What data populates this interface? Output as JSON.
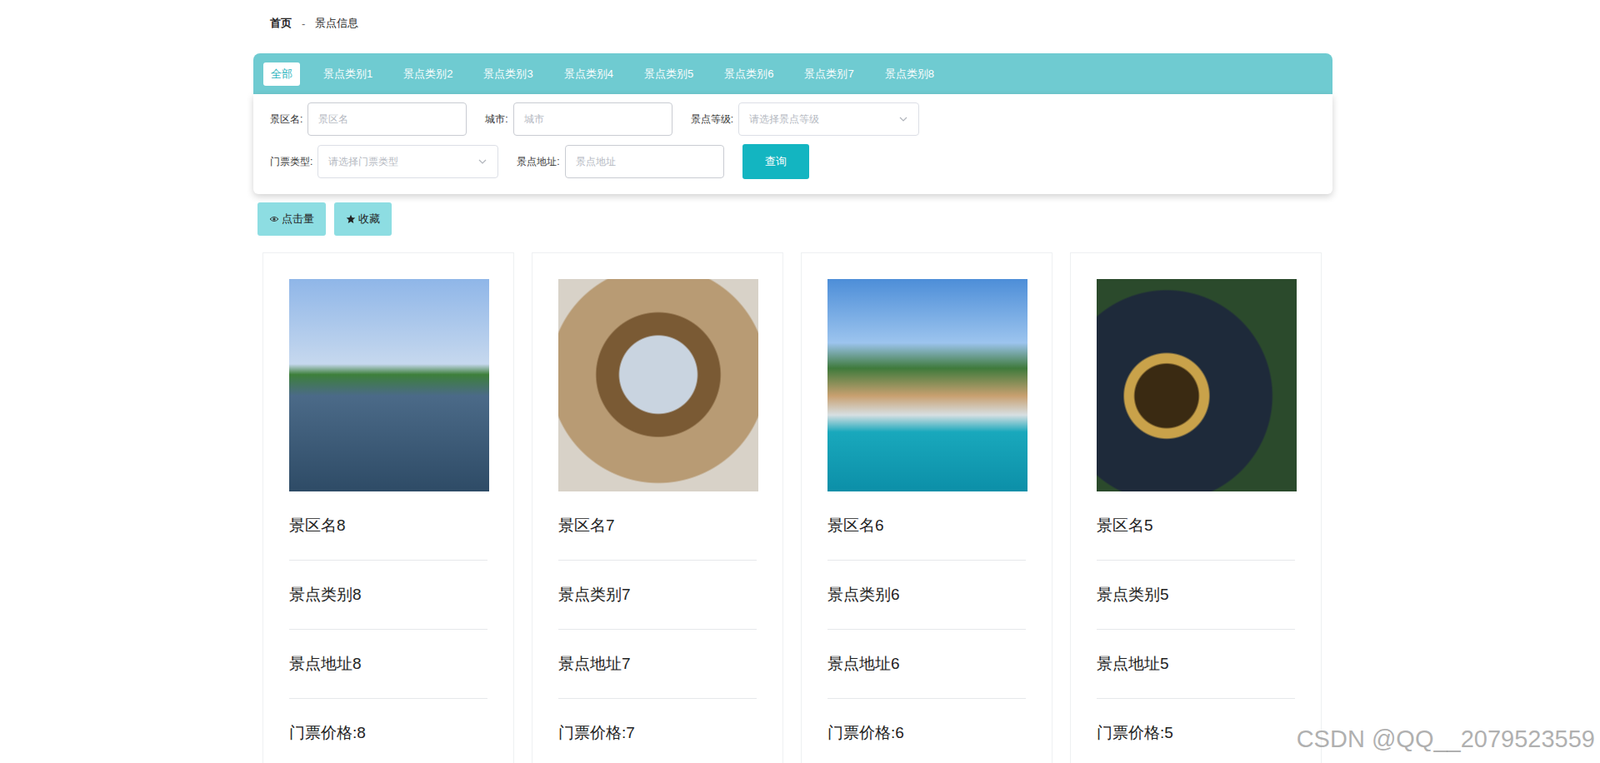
{
  "breadcrumb": {
    "items": [
      "首页",
      "景点信息"
    ],
    "separator": "-"
  },
  "tabs": [
    {
      "label": "全部",
      "selected": true
    },
    {
      "label": "景点类别1",
      "selected": false
    },
    {
      "label": "景点类别2",
      "selected": false
    },
    {
      "label": "景点类别3",
      "selected": false
    },
    {
      "label": "景点类别4",
      "selected": false
    },
    {
      "label": "景点类别5",
      "selected": false
    },
    {
      "label": "景点类别6",
      "selected": false
    },
    {
      "label": "景点类别7",
      "selected": false
    },
    {
      "label": "景点类别8",
      "selected": false
    }
  ],
  "filters": [
    {
      "label": "景区名:",
      "placeholder": "景区名",
      "kind": "input"
    },
    {
      "label": "城市:",
      "placeholder": "城市",
      "kind": "input"
    },
    {
      "label": "景点等级:",
      "placeholder": "请选择景点等级",
      "kind": "select"
    },
    {
      "label": "门票类型:",
      "placeholder": "请选择门票类型",
      "kind": "select"
    },
    {
      "label": "景点地址:",
      "placeholder": "景点地址",
      "kind": "input"
    }
  ],
  "search_button": "查询",
  "sort_buttons": [
    {
      "label": "点击量",
      "kind": "views"
    },
    {
      "label": "收藏",
      "kind": "favorites"
    }
  ],
  "cards": [
    {
      "name": "景区名8",
      "category": "景点类别8",
      "address": "景点地址8",
      "price": "门票价格:8"
    },
    {
      "name": "景区名7",
      "category": "景点类别7",
      "address": "景点地址7",
      "price": "门票价格:7"
    },
    {
      "name": "景区名6",
      "category": "景点类别6",
      "address": "景点地址6",
      "price": "门票价格:6"
    },
    {
      "name": "景区名5",
      "category": "景点类别5",
      "address": "景点地址5",
      "price": "门票价格:5"
    }
  ],
  "watermark": "CSDN @QQ__2079523559"
}
